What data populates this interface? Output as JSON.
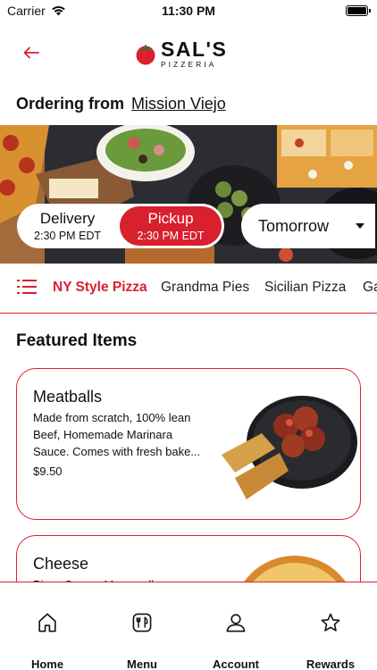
{
  "status_bar": {
    "carrier": "Carrier",
    "time": "11:30 PM"
  },
  "header": {
    "brand_main": "SAL'S",
    "brand_sub": "PIZZERIA"
  },
  "ordering": {
    "label": "Ordering from",
    "location": "Mission Viejo"
  },
  "order_mode": {
    "delivery": {
      "label": "Delivery",
      "time": "2:30 PM EDT"
    },
    "pickup": {
      "label": "Pickup",
      "time": "2:30 PM EDT",
      "selected": true
    },
    "day": "Tomorrow"
  },
  "categories": [
    {
      "label": "NY Style Pizza",
      "active": true
    },
    {
      "label": "Grandma Pies",
      "active": false
    },
    {
      "label": "Sicilian Pizza",
      "active": false
    },
    {
      "label": "Ga",
      "active": false
    }
  ],
  "featured": {
    "title": "Featured Items",
    "items": [
      {
        "name": "Meatballs",
        "description": "Made from scratch, 100% lean Beef, Homemade Marinara Sauce. Comes with fresh bake...",
        "price": "$9.50"
      },
      {
        "name": "Cheese",
        "description": "Pizza Sauce, Mozzarella",
        "price": ""
      }
    ]
  },
  "tabs": [
    {
      "label": "Home",
      "icon": "home-icon"
    },
    {
      "label": "Menu",
      "icon": "menu-utensils-icon"
    },
    {
      "label": "Account",
      "icon": "person-icon"
    },
    {
      "label": "Rewards",
      "icon": "star-icon"
    }
  ],
  "colors": {
    "accent": "#d8202f",
    "text": "#111111"
  }
}
